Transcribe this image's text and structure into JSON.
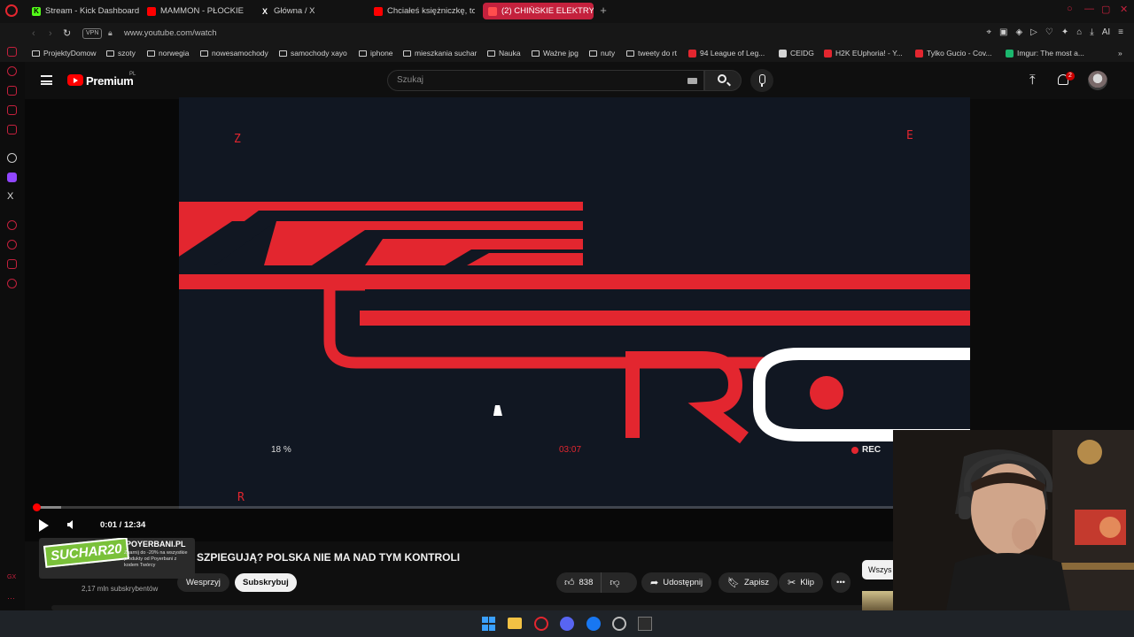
{
  "browser": {
    "tabs": [
      {
        "label": "Stream - Kick Dashboard",
        "icon": "kick-icon",
        "active": false
      },
      {
        "label": "MAMMON - PŁOCKIE KOL",
        "icon": "youtube-icon",
        "active": false
      },
      {
        "label": "Główna / X",
        "icon": "x-icon",
        "active": false
      },
      {
        "label": "Chciałeś księżniczkę, to b",
        "icon": "youtube-icon",
        "active": false
      },
      {
        "label": "(2) CHIŃSKIE ELEKTRYKI",
        "icon": "youtube-icon",
        "active": true
      }
    ],
    "vpn_label": "VPN",
    "url": "www.youtube.com/watch",
    "ai_label": "AI",
    "bookmarks": [
      {
        "label": "ProjektyDomow",
        "type": "folder"
      },
      {
        "label": "szoty",
        "type": "folder"
      },
      {
        "label": "norwegia",
        "type": "folder"
      },
      {
        "label": "nowesamochody",
        "type": "folder"
      },
      {
        "label": "samochody xayo",
        "type": "folder"
      },
      {
        "label": "iphone",
        "type": "folder"
      },
      {
        "label": "mieszkania suchar",
        "type": "folder"
      },
      {
        "label": "Nauka",
        "type": "folder"
      },
      {
        "label": "Ważne jpg",
        "type": "folder"
      },
      {
        "label": "nuty",
        "type": "folder"
      },
      {
        "label": "tweety do rt",
        "type": "folder"
      },
      {
        "label": "94 League of Leg...",
        "type": "site",
        "color": "#e3262f"
      },
      {
        "label": "CEIDG",
        "type": "site",
        "color": "#d4d4d4"
      },
      {
        "label": "H2K EUphoria! - Y...",
        "type": "site",
        "color": "#e3262f"
      },
      {
        "label": "Tylko Gucio - Cov...",
        "type": "site",
        "color": "#e3262f"
      },
      {
        "label": "Imgur: The most a...",
        "type": "site",
        "color": "#1bb76e"
      }
    ]
  },
  "youtube": {
    "brand": "Premium",
    "region": "PL",
    "search_placeholder": "Szukaj",
    "notification_count": "2",
    "video": {
      "overlay_letter_tl": "Z",
      "overlay_letter_tr": "E",
      "overlay_letter_bl": "R",
      "overlay_percent": "18 %",
      "overlay_timecode": "03:07",
      "overlay_rec": "REC",
      "time_current": "0:01",
      "time_total": "12:34",
      "progress_fraction": 0.003,
      "buffer_fraction": 0.032
    },
    "title": "SZPIEGUJĄ? POLSKA NIE MA NAD TYM KONTROLI",
    "subscribers": "2,17 mln subskrybentów",
    "support_label": "Wesprzyj",
    "subscribe_label": "Subskrybuj",
    "likes": "838",
    "share_label": "Udostępnij",
    "save_label": "Zapisz",
    "clip_label": "Klip",
    "chip_label": "Wszys",
    "promo": {
      "code": "SUCHAR20",
      "site": "POYERBANI.PL",
      "text": "Zgarnij do -20% na wszystkie produkty od Poyerbani z kodem Twórcy"
    }
  },
  "colors": {
    "accent_red": "#e3262f",
    "video_bg": "#111722",
    "yt_red": "#ff0000"
  }
}
